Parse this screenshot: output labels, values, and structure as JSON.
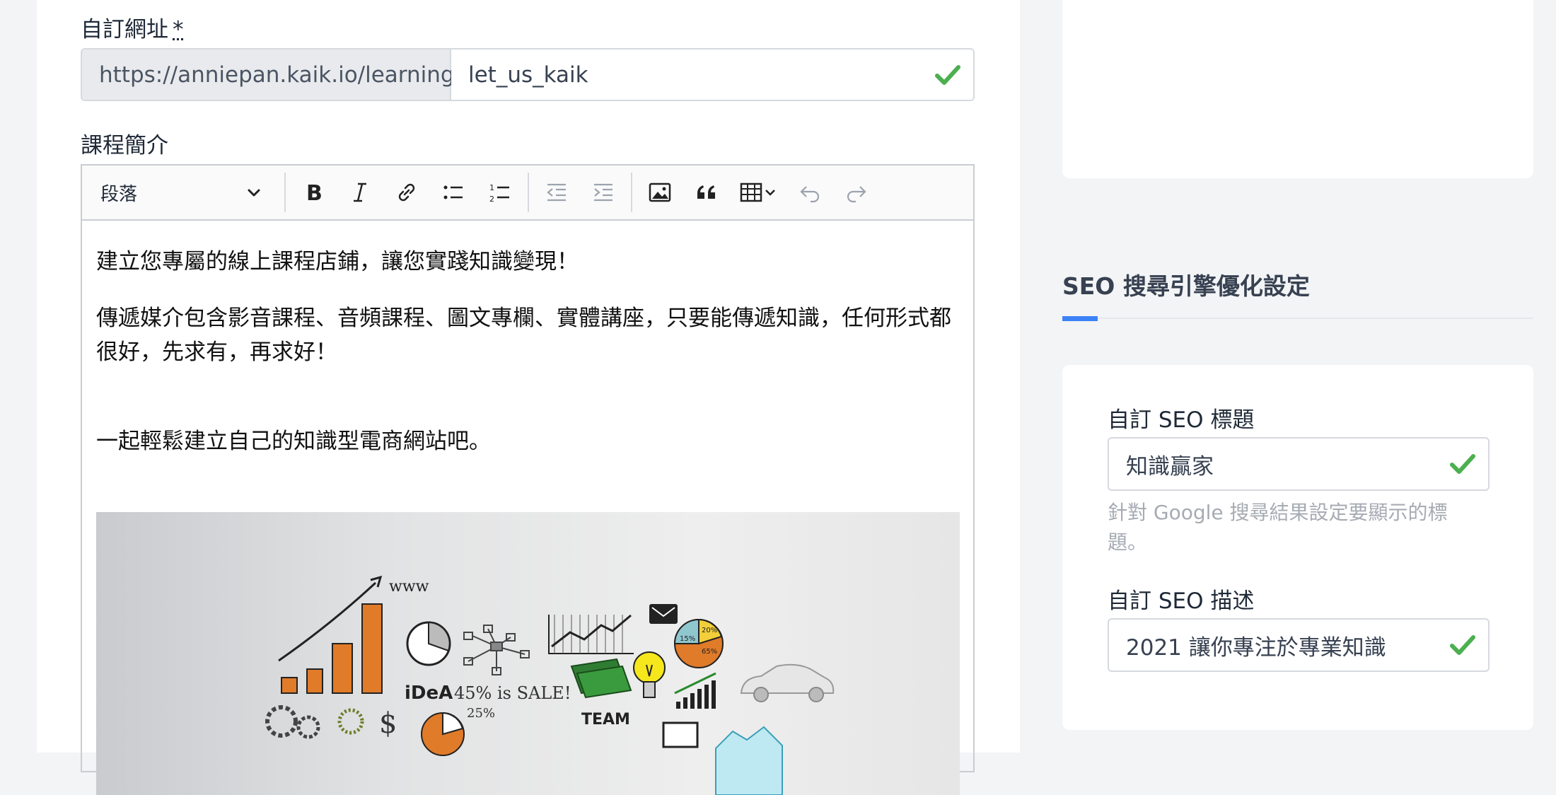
{
  "main": {
    "url_label": "自訂網址",
    "required_mark": "*",
    "url_prefix": "https://anniepan.kaik.io/learning/",
    "url_value": "let_us_kaik",
    "intro_label": "課程簡介",
    "toolbar": {
      "heading_select": "段落"
    },
    "content": {
      "p1": "建立您專屬的線上課程店鋪，讓您實踐知識變現！",
      "p2": "傳遞媒介包含影音課程、音頻課程、圖文專欄、實體講座，只要能傳遞知識，任何形式都很好，先求有，再求好！",
      "p3": "一起輕鬆建立自己的知識型電商網站吧。",
      "image_text": {
        "www": "www",
        "idea": "iDeA",
        "sale": "45% is SALE!",
        "pct": "25%",
        "team": "TEAM",
        "pie_a": "20%",
        "pie_b": "15%",
        "pie_c": "65%"
      }
    }
  },
  "seo": {
    "section_title": "SEO 搜尋引擎優化設定",
    "title_label": "自訂 SEO 標題",
    "title_value": "知識贏家",
    "title_help": "針對 Google 搜尋結果設定要顯示的標題。",
    "desc_label": "自訂 SEO 描述",
    "desc_value": "2021 讓你專注於專業知識"
  },
  "colors": {
    "valid_check": "#4caf50",
    "accent": "#3b82f6"
  }
}
